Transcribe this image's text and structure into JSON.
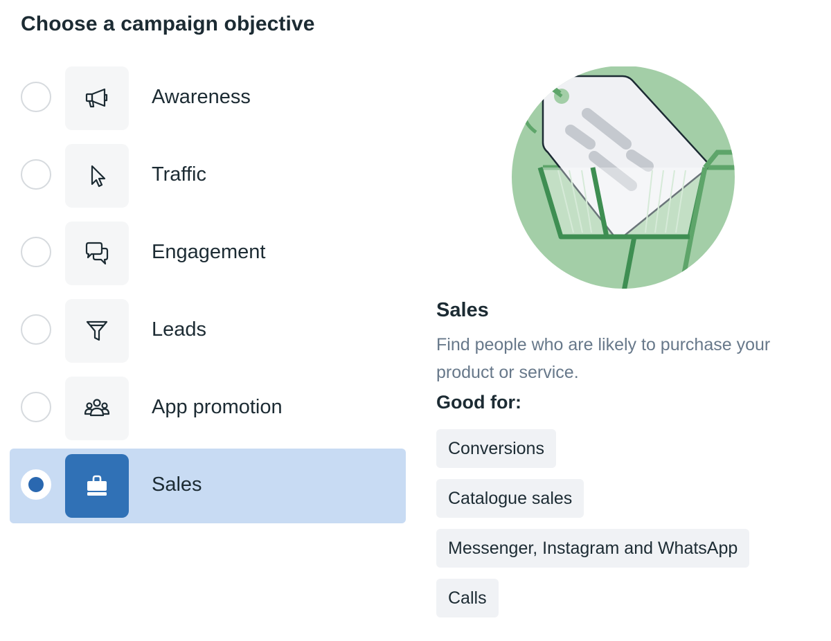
{
  "heading": "Choose a campaign objective",
  "objectives": [
    {
      "label": "Awareness",
      "icon": "megaphone-icon",
      "selected": false
    },
    {
      "label": "Traffic",
      "icon": "cursor-icon",
      "selected": false
    },
    {
      "label": "Engagement",
      "icon": "chat-bubbles-icon",
      "selected": false
    },
    {
      "label": "Leads",
      "icon": "funnel-icon",
      "selected": false
    },
    {
      "label": "App promotion",
      "icon": "people-group-icon",
      "selected": false
    },
    {
      "label": "Sales",
      "icon": "shopping-bag-icon",
      "selected": true
    }
  ],
  "detail": {
    "illustration": "shopping-basket-tag-illustration",
    "title": "Sales",
    "description": "Find people who are likely to purchase your product or service.",
    "good_for_label": "Good for:",
    "good_for": [
      "Conversions",
      "Catalogue sales",
      "Messenger, Instagram and WhatsApp",
      "Calls"
    ]
  },
  "colors": {
    "text": "#1c2b33",
    "muted_text": "#67788a",
    "selected_row": "#c8dbf3",
    "selected_icon_bg": "#3071b6",
    "radio_dot": "#2a68b0",
    "icon_bg": "#f5f6f7",
    "chip_bg": "#f0f2f5",
    "illustration_green": "#a3cea7"
  }
}
